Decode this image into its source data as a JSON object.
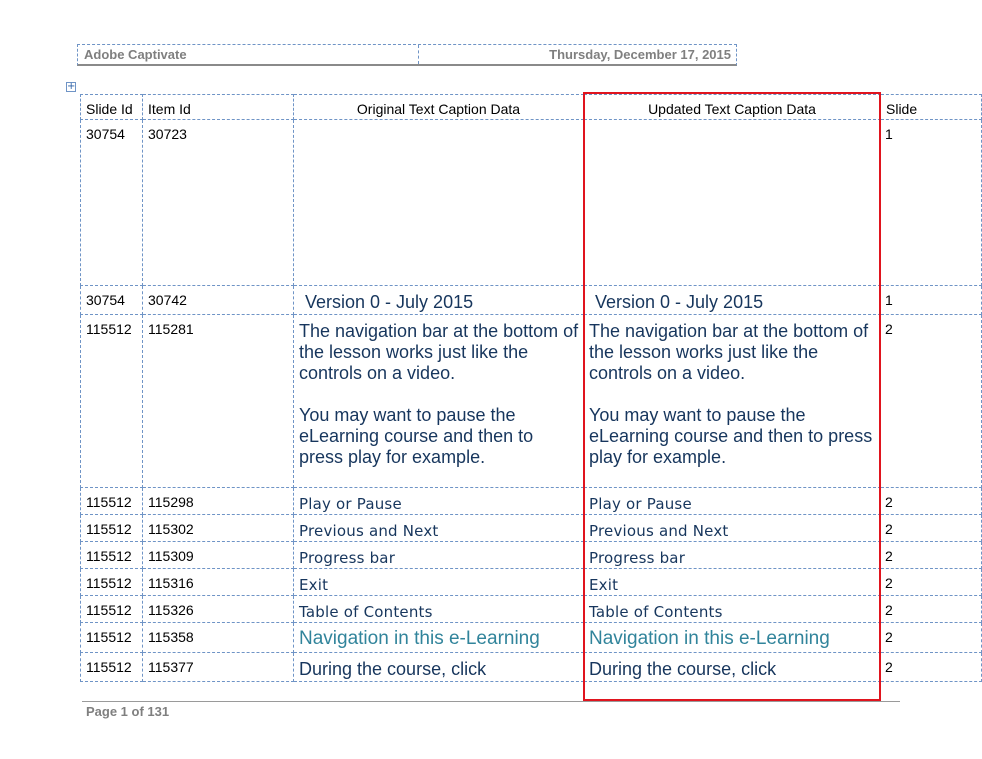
{
  "header": {
    "app_name": "Adobe Captivate",
    "date": "Thursday, December 17, 2015"
  },
  "table": {
    "headers": {
      "slide_id": "Slide Id",
      "item_id": "Item Id",
      "original": "Original Text Caption Data",
      "updated": "Updated Text Caption Data",
      "slide": "Slide"
    },
    "rows": [
      {
        "slide_id": "30754",
        "item_id": "30723",
        "original": "",
        "updated": "",
        "slide": "1"
      },
      {
        "slide_id": "30754",
        "item_id": "30742",
        "original": "Version 0 - July 2015",
        "updated": "Version 0 - July 2015",
        "slide": "1"
      },
      {
        "slide_id": "115512",
        "item_id": "115281",
        "original_p1": "The navigation bar at the bottom of the lesson works just like the controls on a video.",
        "original_p2": "You may want to pause the eLearning course and then to press play for example.",
        "updated_p1": "The navigation bar at the bottom of the lesson works just like the controls on a video.",
        "updated_p2": "You may want to pause the eLearning course and then to press play for example.",
        "slide": "2"
      },
      {
        "slide_id": "115512",
        "item_id": "115298",
        "original": "Play or Pause",
        "updated": "Play or Pause",
        "slide": "2"
      },
      {
        "slide_id": "115512",
        "item_id": "115302",
        "original": "Previous and Next",
        "updated": "Previous and Next",
        "slide": "2"
      },
      {
        "slide_id": "115512",
        "item_id": "115309",
        "original": "Progress bar",
        "updated": "Progress bar",
        "slide": "2"
      },
      {
        "slide_id": "115512",
        "item_id": "115316",
        "original": "Exit",
        "updated": "Exit",
        "slide": "2"
      },
      {
        "slide_id": "115512",
        "item_id": "115326",
        "original": "Table of Contents",
        "updated": "Table of Contents",
        "slide": "2"
      },
      {
        "slide_id": "115512",
        "item_id": "115358",
        "original": "Navigation in this e-Learning",
        "updated": "Navigation in this e-Learning",
        "slide": "2"
      },
      {
        "slide_id": "115512",
        "item_id": "115377",
        "original": "During the course, click",
        "updated": "During the course, click",
        "slide": "2"
      }
    ]
  },
  "footer": {
    "page_label": "Page 1 of 131"
  },
  "colors": {
    "caption_text": "#17365d",
    "caption_teal": "#31849b",
    "highlight_border": "#e0141e",
    "grid_dashed": "#6f94c6"
  }
}
